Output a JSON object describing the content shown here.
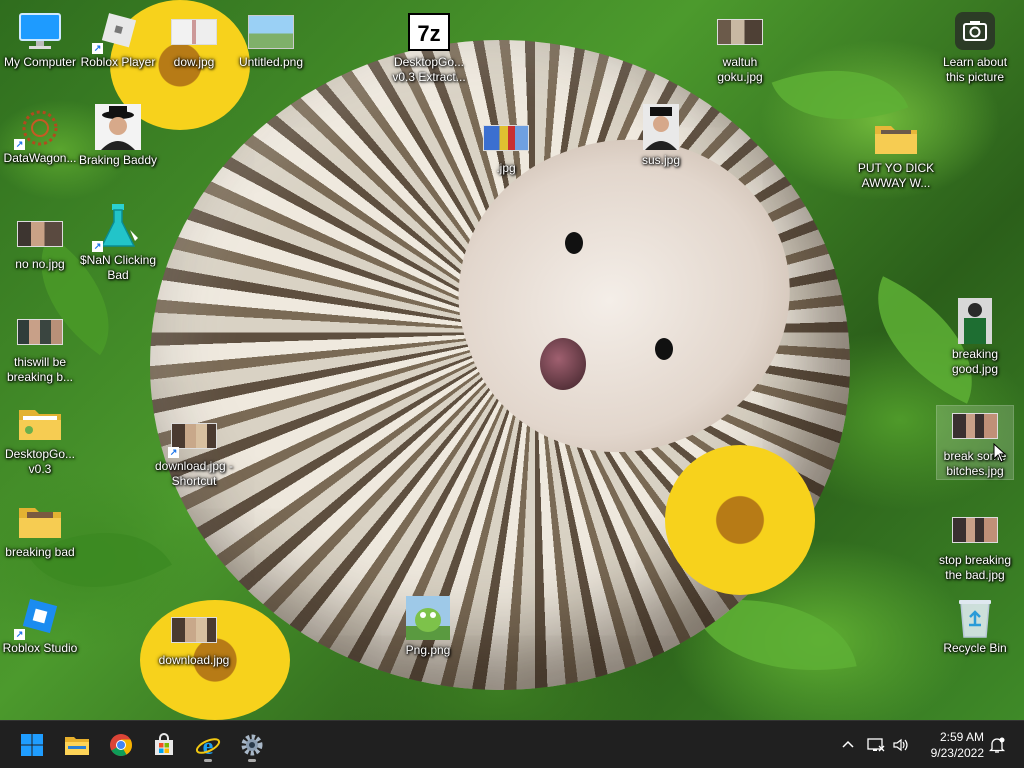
{
  "desktop": {
    "icons": [
      {
        "label": "My Computer",
        "icon": "monitor-icon"
      },
      {
        "label": "Roblox Player",
        "icon": "roblox-icon"
      },
      {
        "label": "dow.jpg",
        "icon": "image-thumbnail"
      },
      {
        "label": "Untitled.png",
        "icon": "image-thumbnail"
      },
      {
        "label": "DesktopGo... v0.3 Extract...",
        "icon": "7zip-icon"
      },
      {
        "label": "waltuh goku.jpg",
        "icon": "image-thumbnail"
      },
      {
        "label": "Learn about this picture",
        "icon": "camera-icon"
      },
      {
        "label": "DataWagon...",
        "icon": "datawagon-icon"
      },
      {
        "label": "Braking Baddy",
        "icon": "image-thumbnail"
      },
      {
        "label": ".jpg",
        "icon": "image-thumbnail"
      },
      {
        "label": "sus.jpg",
        "icon": "image-thumbnail"
      },
      {
        "label": "PUT YO DICK AWWAY W...",
        "icon": "folder-icon"
      },
      {
        "label": "no no.jpg",
        "icon": "image-thumbnail"
      },
      {
        "label": "$NaN Clicking Bad",
        "icon": "flask-icon"
      },
      {
        "label": "thiswill be breaking b...",
        "icon": "image-thumbnail"
      },
      {
        "label": "breaking good.jpg",
        "icon": "image-thumbnail"
      },
      {
        "label": "DesktopGo... v0.3",
        "icon": "folder-icon"
      },
      {
        "label": "download.jpg - Shortcut",
        "icon": "image-thumbnail"
      },
      {
        "label": "break some bitches.jpg",
        "icon": "image-thumbnail"
      },
      {
        "label": "breaking bad",
        "icon": "folder-icon"
      },
      {
        "label": "stop breaking the bad.jpg",
        "icon": "image-thumbnail"
      },
      {
        "label": "Roblox Studio",
        "icon": "roblox-studio-icon"
      },
      {
        "label": "download.jpg",
        "icon": "image-thumbnail"
      },
      {
        "label": "Png.png",
        "icon": "image-thumbnail"
      },
      {
        "label": "Recycle Bin",
        "icon": "recycle-bin-icon"
      }
    ]
  },
  "taskbar": {
    "apps": [
      {
        "name": "Start",
        "icon": "windows-start-icon"
      },
      {
        "name": "File Explorer",
        "icon": "folder-icon"
      },
      {
        "name": "Google Chrome",
        "icon": "chrome-icon"
      },
      {
        "name": "Microsoft Store",
        "icon": "store-icon"
      },
      {
        "name": "Internet Explorer",
        "icon": "ie-icon"
      },
      {
        "name": "Settings",
        "icon": "gear-icon"
      }
    ],
    "clock": {
      "time": "2:59 AM",
      "date": "9/23/2022"
    }
  },
  "colors": {
    "taskbar": "#202020",
    "accent": "#0078d4"
  }
}
